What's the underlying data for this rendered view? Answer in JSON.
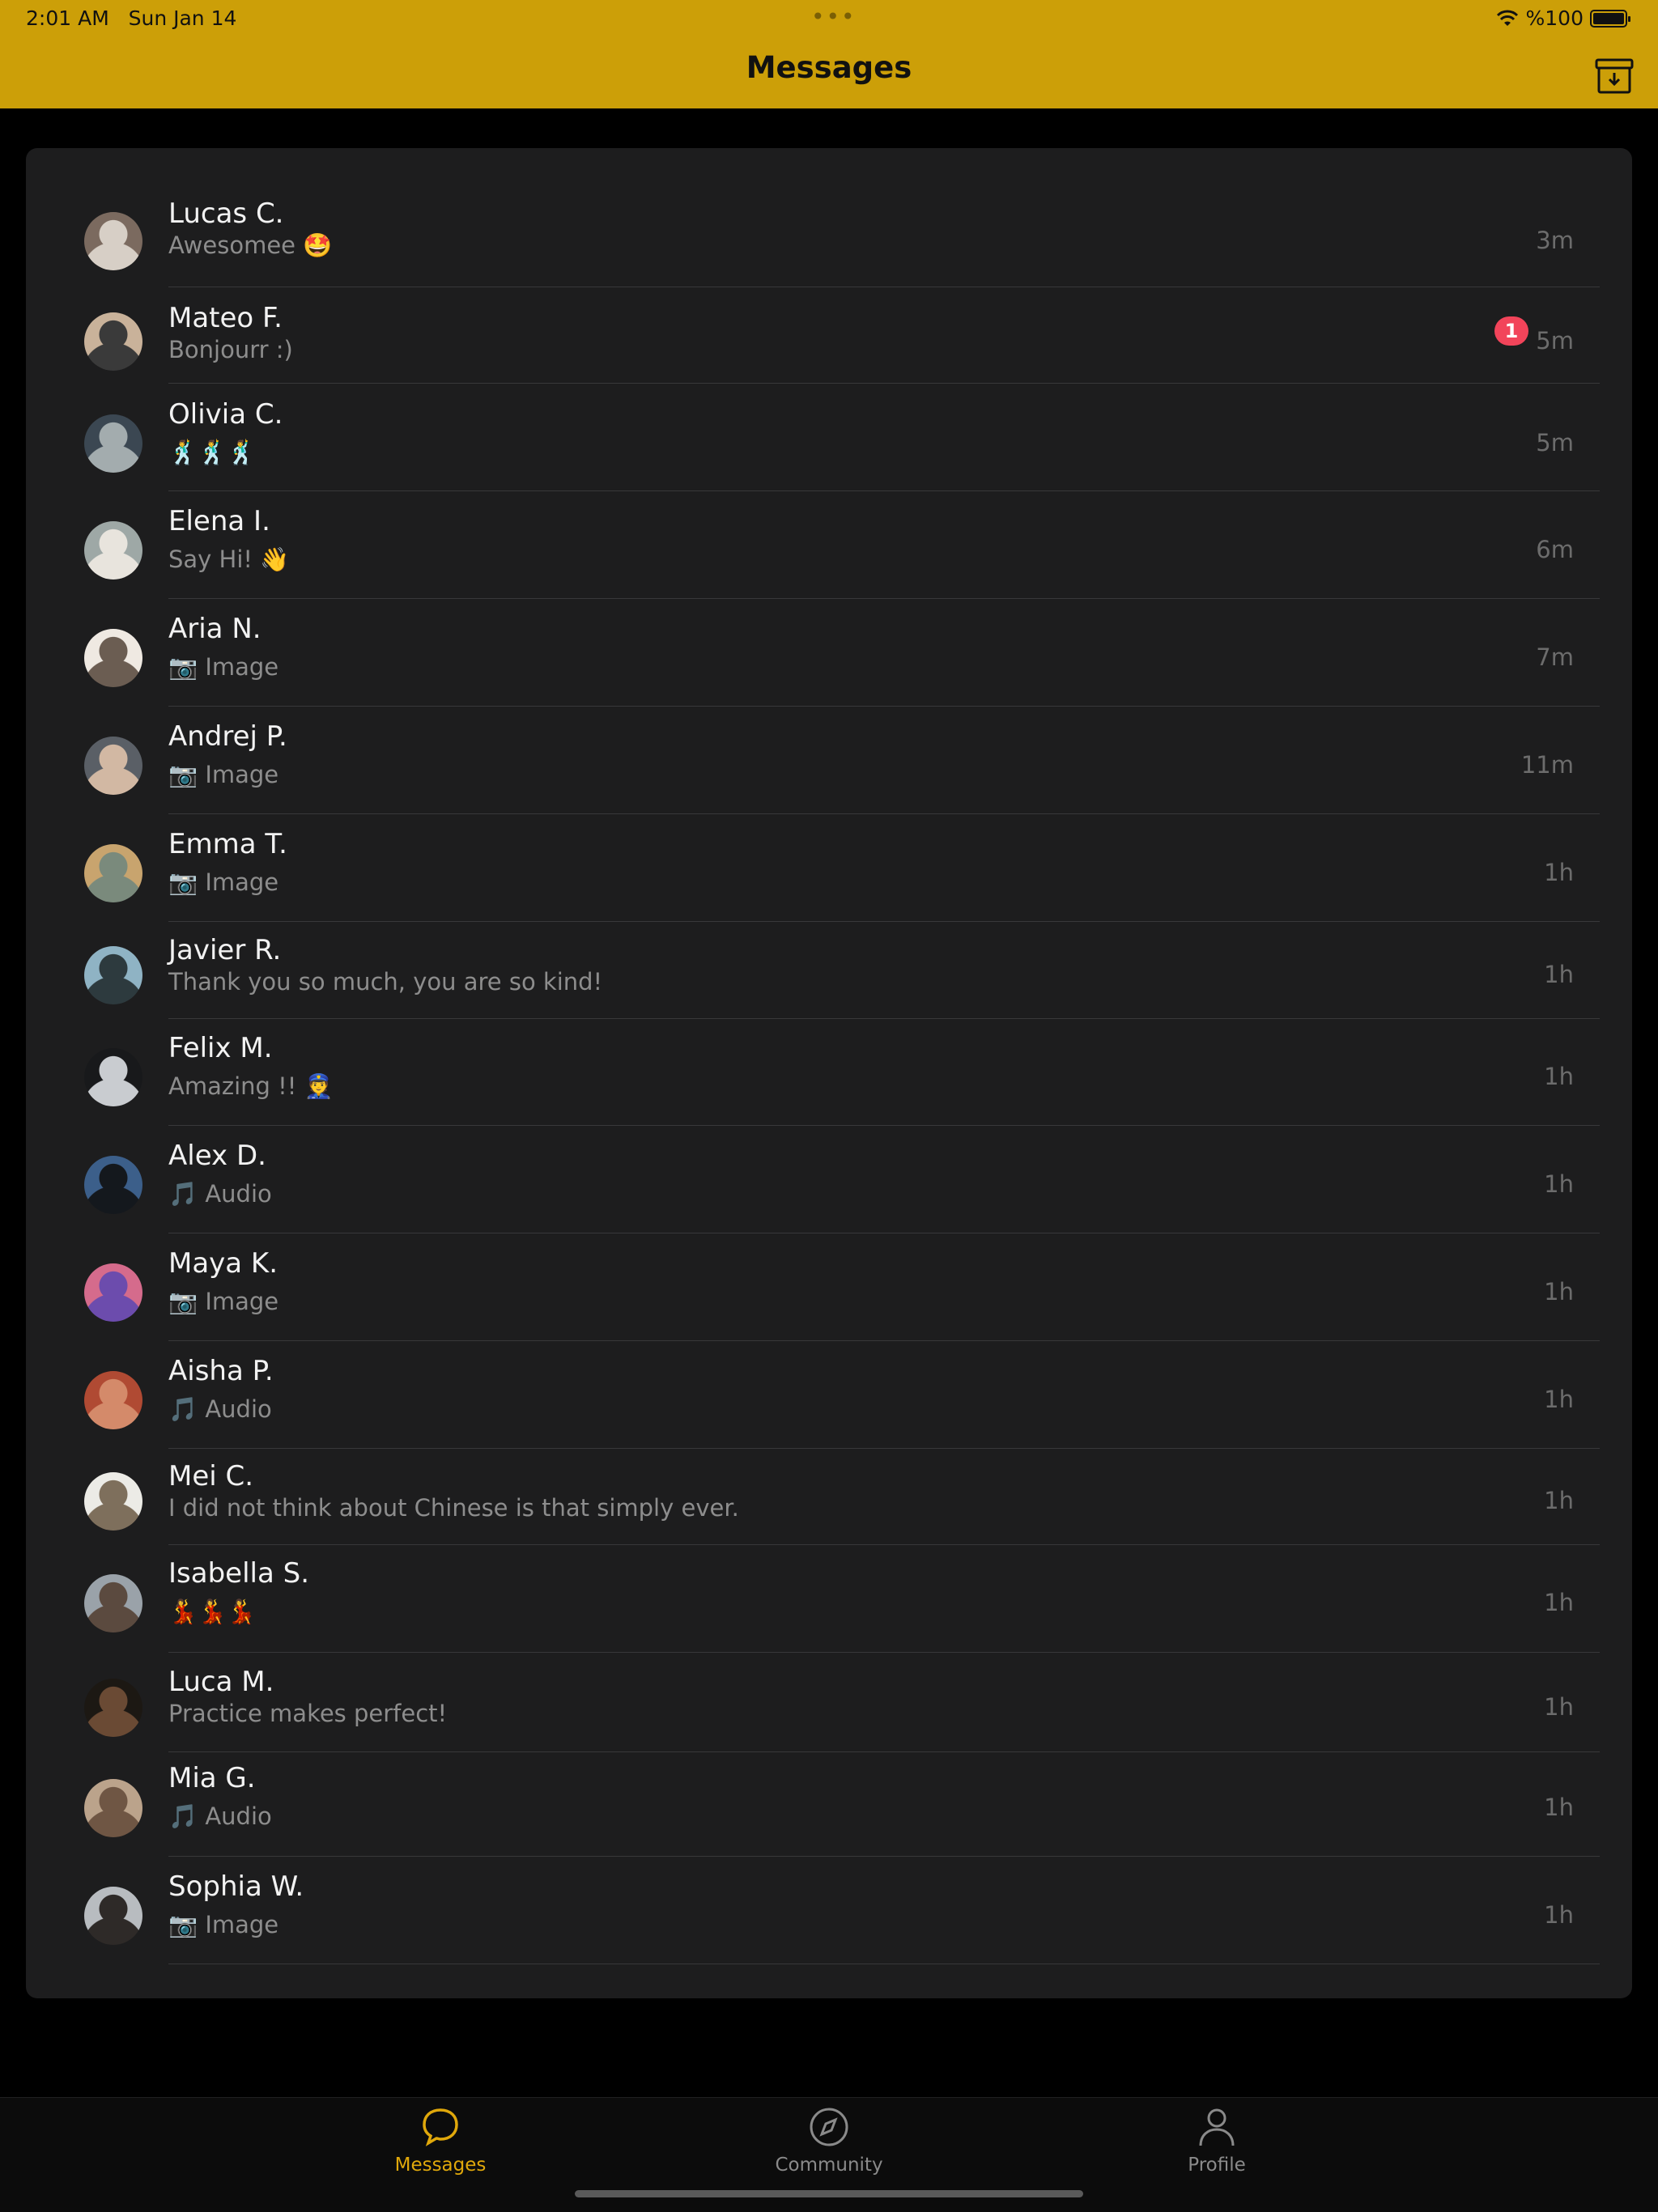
{
  "status": {
    "time": "2:01 AM",
    "date": "Sun Jan 14",
    "battery": "%100"
  },
  "header": {
    "title": "Messages"
  },
  "conversations": [
    {
      "name": "Lucas C.",
      "preview": "Awesomee 🤩",
      "time": "3m"
    },
    {
      "name": "Mateo F.",
      "preview": "Bonjourr :)",
      "time": "5m",
      "badge": "1"
    },
    {
      "name": "Olivia C.",
      "preview": "🕺🕺🕺",
      "time": "5m"
    },
    {
      "name": "Elena I.",
      "preview": "Say Hi! 👋",
      "time": "6m"
    },
    {
      "name": "Aria N.",
      "preview": "📷 Image",
      "time": "7m"
    },
    {
      "name": "Andrej P.",
      "preview": "📷 Image",
      "time": "11m"
    },
    {
      "name": "Emma T.",
      "preview": "📷 Image",
      "time": "1h"
    },
    {
      "name": "Javier R.",
      "preview": "Thank you so much, you are so kind!",
      "time": "1h"
    },
    {
      "name": "Felix M.",
      "preview": "Amazing !! 👮",
      "time": "1h"
    },
    {
      "name": "Alex D.",
      "preview": "🎵 Audio",
      "time": "1h"
    },
    {
      "name": "Maya K.",
      "preview": "📷 Image",
      "time": "1h"
    },
    {
      "name": "Aisha P.",
      "preview": "🎵 Audio",
      "time": "1h"
    },
    {
      "name": "Mei C.",
      "preview": "I did not think about Chinese is that simply ever.",
      "time": "1h"
    },
    {
      "name": "Isabella S.",
      "preview": "💃💃💃",
      "time": "1h"
    },
    {
      "name": "Luca M.",
      "preview": "Practice makes perfect!",
      "time": "1h"
    },
    {
      "name": "Mia G.",
      "preview": "🎵 Audio",
      "time": "1h"
    },
    {
      "name": "Sophia W.",
      "preview": "📷 Image",
      "time": "1h"
    }
  ],
  "tabs": [
    {
      "label": "Messages",
      "icon": "chat-bubble-icon",
      "active": true
    },
    {
      "label": "Community",
      "icon": "compass-icon",
      "active": false
    },
    {
      "label": "Profile",
      "icon": "person-icon",
      "active": false
    }
  ],
  "colors": {
    "accent": "#cc9f08",
    "badge": "#f2445a",
    "background": "#000000",
    "card": "#1d1d1e"
  }
}
